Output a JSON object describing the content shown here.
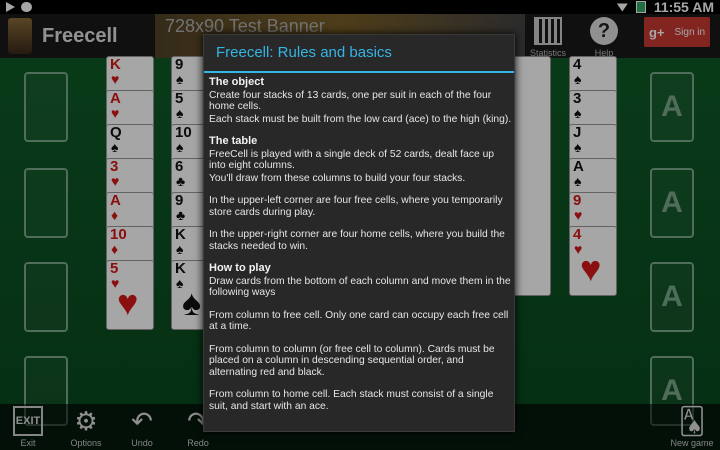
{
  "status_bar": {
    "time": "11:55 AM"
  },
  "action_bar": {
    "title": "Freecell",
    "banner_text": "728x90   Test Banner",
    "statistics_label": "Statistics",
    "help_label": "Help",
    "help_glyph": "?",
    "signin_glyph": "g+",
    "signin_label": "Sign in"
  },
  "table": {
    "home_cell_label": "A",
    "columns": [
      {
        "cards": [
          {
            "rank": "K",
            "suit": "♥",
            "color": "red"
          },
          {
            "rank": "A",
            "suit": "♥",
            "color": "red"
          },
          {
            "rank": "Q",
            "suit": "♠",
            "color": "black"
          },
          {
            "rank": "3",
            "suit": "♥",
            "color": "red"
          },
          {
            "rank": "A",
            "suit": "♦",
            "color": "red"
          },
          {
            "rank": "10",
            "suit": "♦",
            "color": "red"
          },
          {
            "rank": "5",
            "suit": "♥",
            "color": "red"
          }
        ]
      },
      {
        "cards": [
          {
            "rank": "9",
            "suit": "♠",
            "color": "black"
          },
          {
            "rank": "5",
            "suit": "♠",
            "color": "black"
          },
          {
            "rank": "10",
            "suit": "♠",
            "color": "black"
          },
          {
            "rank": "6",
            "suit": "♣",
            "color": "black"
          },
          {
            "rank": "9",
            "suit": "♣",
            "color": "black"
          },
          {
            "rank": "K",
            "suit": "♠",
            "color": "black"
          },
          {
            "rank": "K",
            "suit": "♠",
            "color": "black"
          }
        ]
      },
      {
        "cards": [
          {
            "rank": "4",
            "suit": "♠",
            "color": "black"
          },
          {
            "rank": "3",
            "suit": "♠",
            "color": "black"
          },
          {
            "rank": "J",
            "suit": "♠",
            "color": "black"
          },
          {
            "rank": "A",
            "suit": "♠",
            "color": "black"
          },
          {
            "rank": "9",
            "suit": "♥",
            "color": "red"
          },
          {
            "rank": "4",
            "suit": "♥",
            "color": "red"
          }
        ]
      }
    ]
  },
  "dialog": {
    "title": "Freecell: Rules and basics",
    "object_heading": "The object",
    "object_p1": "Create four stacks of 13 cards, one per suit in each of the four home cells.",
    "object_p2": "Each stack must be built from the low card (ace) to the high (king).",
    "table_heading": "The table",
    "table_p1": "FreeCell is played with a single deck of 52 cards, dealt face up into eight columns.",
    "table_p2": "You'll draw from these columns to build your four stacks.",
    "table_p3": "In the upper-left corner are four free cells, where you temporarily store cards during play.",
    "table_p4": "In the upper-right corner are four home cells, where you build the stacks needed to win.",
    "howto_heading": "How to play",
    "howto_p1": "Draw cards from the bottom of each column and move them in the following ways",
    "howto_p2": "From column to free cell. Only one card can occupy each free cell at a time.",
    "howto_p3": "From column to column (or free cell to column). Cards must be placed on a column in descending sequential order, and alternating red and black.",
    "howto_p4": "From column to home cell. Each stack must consist of a single suit, and start with an ace."
  },
  "toolbar": {
    "exit_glyph": "EXIT",
    "exit_label": "Exit",
    "options_label": "Options",
    "undo_label": "Undo",
    "redo_label": "Redo",
    "newgame_label": "New game"
  }
}
